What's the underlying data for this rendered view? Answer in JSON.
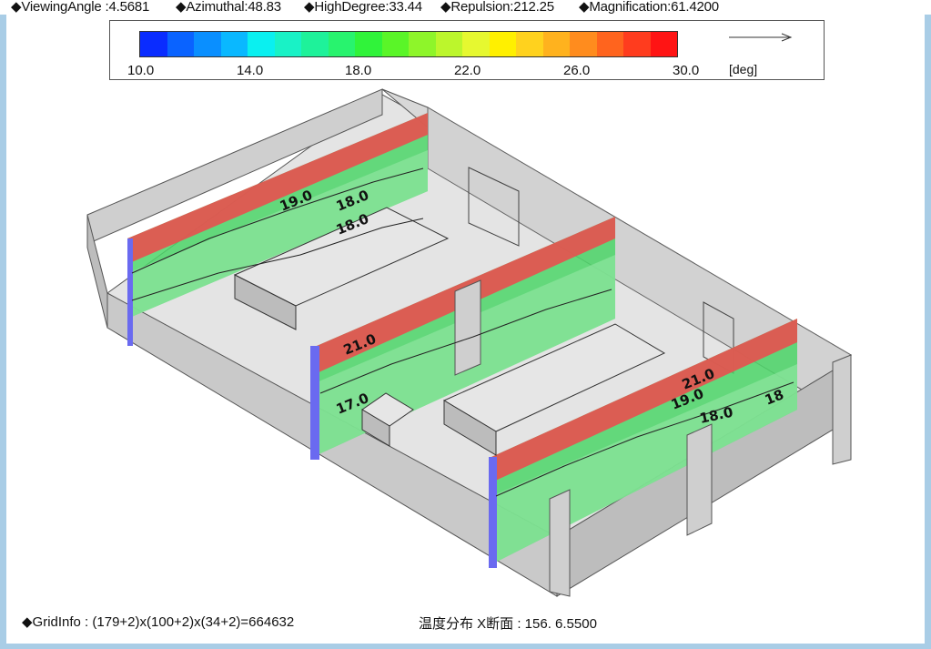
{
  "header": {
    "viewing_angle": "◆ViewingAngle :4.5681",
    "azimuthal": "◆Azimuthal:48.83",
    "high_degree": "◆HighDegree:33.44",
    "repulsion": "◆Repulsion:212.25",
    "magnification": "◆Magnification:61.4200"
  },
  "legend": {
    "ticks": [
      "10.0",
      "14.0",
      "18.0",
      "22.0",
      "26.0",
      "30.0"
    ],
    "unit": "[deg]",
    "colors": [
      "#0a2cff",
      "#0a63ff",
      "#0a8fff",
      "#0ab8ff",
      "#0af0f0",
      "#19f2c6",
      "#1ef29a",
      "#28f36e",
      "#30f33a",
      "#5af528",
      "#8ef52a",
      "#bcf62c",
      "#e6f830",
      "#fff000",
      "#ffd21e",
      "#ffb21e",
      "#ff8c1e",
      "#ff641e",
      "#ff3c1e",
      "#ff1414"
    ]
  },
  "scene": {
    "contour_labels": [
      "19.0",
      "18.0",
      "18.0",
      "21.0",
      "17.0",
      "21.0",
      "19.0",
      "18.0",
      "18"
    ],
    "colors": {
      "hot": "#e8504f",
      "warm": "#4cd669",
      "cool": "#8ee6a0",
      "blue_edge": "#6a6af0",
      "wall": "#cfcfcf",
      "floor": "#e4e4e4"
    }
  },
  "footer": {
    "grid_info": "◆GridInfo : (179+2)x(100+2)x(34+2)=664632",
    "section": "温度分布 X断面 : 156. 6.5500"
  }
}
